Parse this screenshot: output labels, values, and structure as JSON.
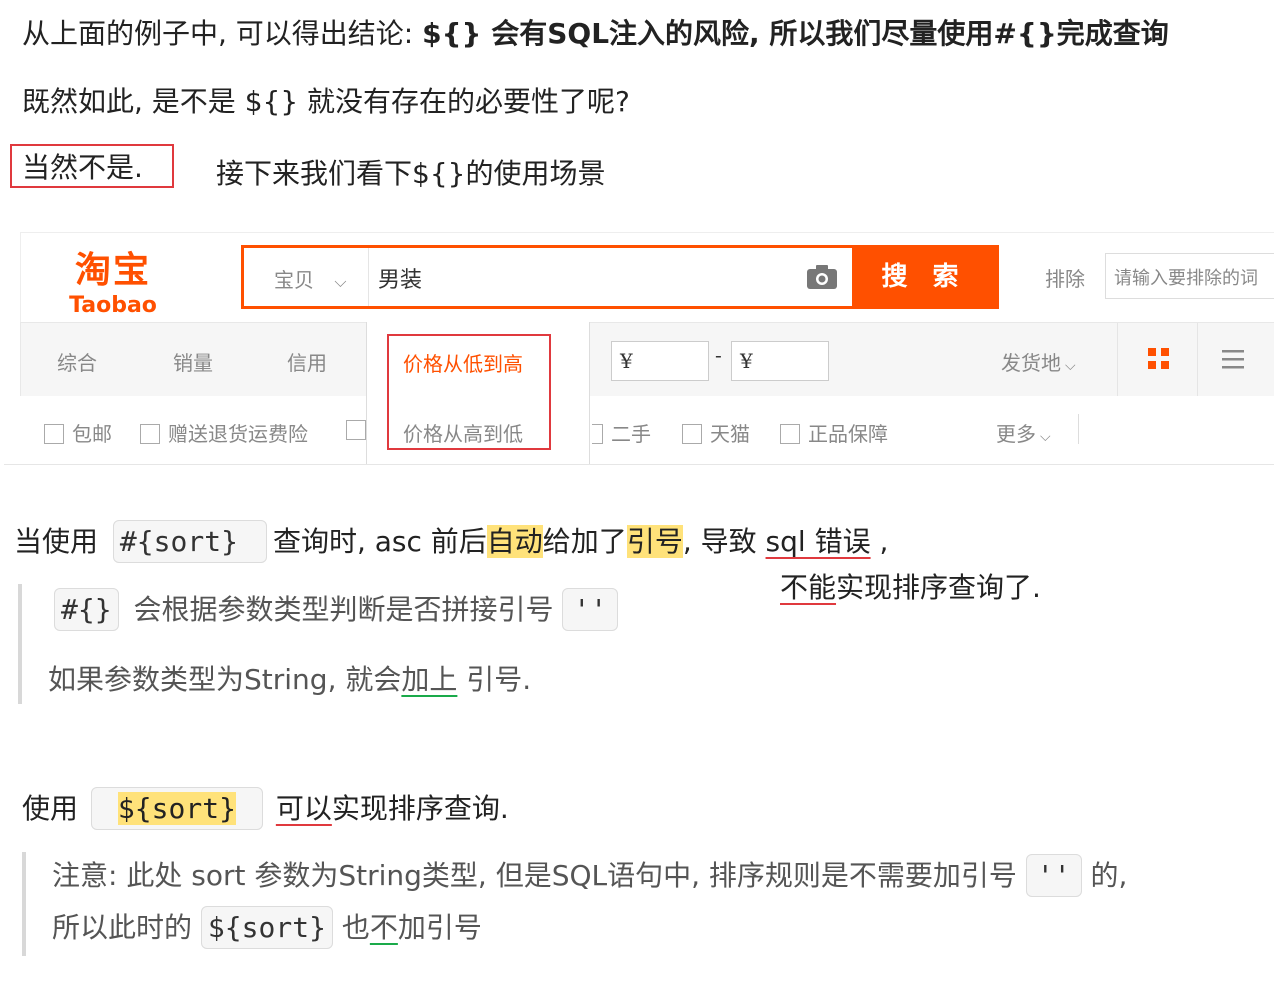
{
  "lines": {
    "line1_normal": "从上面的例子中, 可以得出结论: ",
    "line1_bold": "${} 会有SQL注入的风险, 所以我们尽量使用#{}完成查询",
    "line2": "既然如此, 是不是 ${} 就没有存在的必要性了呢?",
    "line3_boxed": "当然不是.",
    "line3_rest": "接下来我们看下${}的使用场景"
  },
  "taobao": {
    "logo_cn": "淘宝",
    "logo_en": "Taobao",
    "search_category": "宝贝",
    "search_value": "男装",
    "search_button": "搜 索",
    "exclude_label": "排除",
    "exclude_placeholder": "请输入要排除的词",
    "sort_tabs": [
      "综合",
      "销量",
      "信用"
    ],
    "price_sort_asc": "价格从低到高",
    "price_sort_desc": "价格从高到低",
    "price_min": "¥",
    "price_sep": "-",
    "price_max": "¥",
    "ship_from": "发货地",
    "checkboxes_left": [
      "包邮",
      "赠送退货运费险"
    ],
    "checkboxes_right": [
      "二手",
      "天猫",
      "正品保障"
    ],
    "more": "更多"
  },
  "section1": {
    "prefix": "当使用",
    "code": "#{sort}",
    "t1": "查询时, asc 前后",
    "hl1": "自动",
    "t2": "给加了",
    "hl2": "引号",
    "t3": ", 导致 ",
    "err": "sql 错误",
    "t4": " ,",
    "line2_red": "不能",
    "line2_rest": "实现排序查询了.",
    "q1_code": "#{}",
    "q1_text": "会根据参数类型判断是否拼接引号",
    "q1_code2": "''",
    "q2_text1": "如果参数类型为String, 就会",
    "q2_green": "加上",
    "q2_text2": " 引号."
  },
  "section2": {
    "prefix": "使用",
    "code": "${sort}",
    "red": "可以",
    "rest": "实现排序查询.",
    "n1_text": "注意: 此处 sort 参数为String类型, 但是SQL语句中, 排序规则是不需要加引号",
    "n1_code": "''",
    "n1_end": " 的,",
    "n2_text1": "所以此时的",
    "n2_code": "${sort}",
    "n2_text2": "也",
    "n2_green": "不",
    "n2_text3": "加引号"
  },
  "colors": {
    "taobao_orange": "#ff5000",
    "highlight": "#ffe27a",
    "red": "#e0393e",
    "green": "#1aaa4a"
  }
}
